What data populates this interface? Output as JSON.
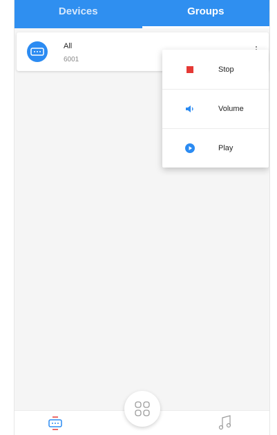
{
  "tabs": [
    {
      "label": "Devices",
      "active": false
    },
    {
      "label": "Groups",
      "active": true
    }
  ],
  "group": {
    "name": "All",
    "id": "6001",
    "icon": "speaker-icon"
  },
  "menu": {
    "items": [
      {
        "label": "Stop",
        "icon": "stop-icon",
        "color": "#e53935"
      },
      {
        "label": "Volume",
        "icon": "volume-icon",
        "color": "#2b8bf2"
      },
      {
        "label": "Play",
        "icon": "play-icon",
        "color": "#2b8bf2"
      }
    ]
  },
  "bottom_nav": {
    "items": [
      {
        "icon": "devices-icon"
      },
      {
        "icon": "apps-grid-icon"
      },
      {
        "icon": "music-note-icon"
      }
    ]
  },
  "colors": {
    "accent": "#2f8ff0",
    "stop": "#e53935"
  }
}
